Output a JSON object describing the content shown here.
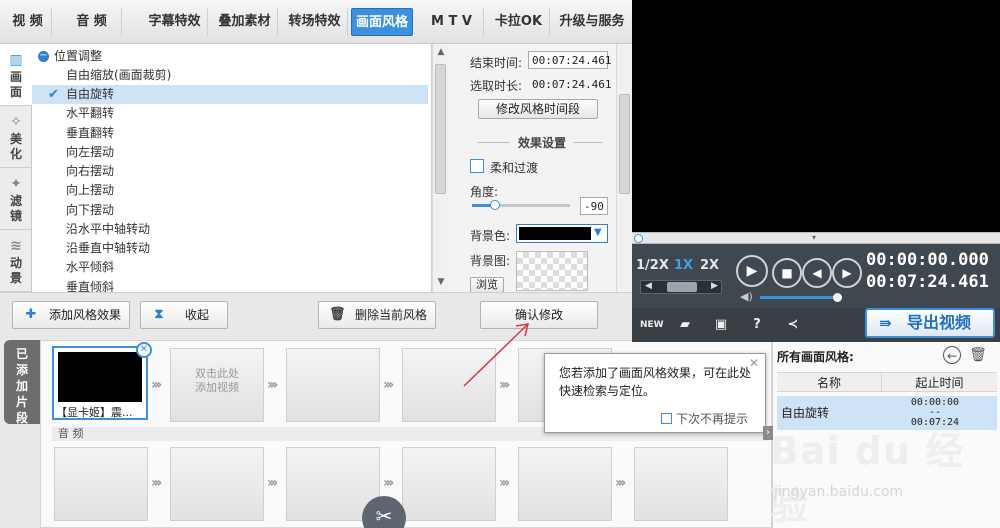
{
  "top_tabs": [
    "视  频",
    "音  频",
    "字幕特效",
    "叠加素材",
    "转场特效",
    "画面风格",
    "M T V",
    "卡拉OK",
    "升级与服务"
  ],
  "top_tabs_active": "画面风格",
  "side_tabs": [
    {
      "label": "画面",
      "icon": "picture-icon",
      "active": true
    },
    {
      "label": "美化",
      "icon": "beautify-wand-icon",
      "active": false
    },
    {
      "label": "滤镜",
      "icon": "filter-wand-icon",
      "active": false
    },
    {
      "label": "动景",
      "icon": "motion-wave-icon",
      "active": false
    }
  ],
  "effect_list": {
    "group": "位置调整",
    "items": [
      "自由缩放(画面裁剪)",
      "自由旋转",
      "水平翻转",
      "垂直翻转",
      "向左摆动",
      "向右摆动",
      "向上摆动",
      "向下摆动",
      "沿水平中轴转动",
      "沿垂直中轴转动",
      "水平倾斜",
      "垂直倾斜"
    ],
    "selected": "自由旋转"
  },
  "settings": {
    "end_time_label": "结束时间:",
    "end_time_value": "00:07:24.461",
    "selected_duration_label": "选取时长:",
    "selected_duration_value": "00:07:24.461",
    "modify_period_button": "修改风格时间段",
    "effect_settings_title": "效果设置",
    "soft_transition_label": "柔和过渡",
    "angle_label": "角度:",
    "angle_value": "-90",
    "bg_color_label": "背景色:",
    "bg_color_hex": "#000000",
    "bg_image_label": "背景图:",
    "browse_button": "浏览"
  },
  "toolbar": {
    "add_style_button": "添加风格效果",
    "collapse_button": "收起",
    "delete_style_button": "删除当前风格",
    "confirm_button": "确认修改"
  },
  "timeline": {
    "added_clips_tab": "已添加片段",
    "clip_name": "【显卡姬】震...",
    "empty_slot_hint_line1": "双击此处",
    "empty_slot_hint_line2": "添加视频",
    "audio_label": "音  频"
  },
  "tooltip": {
    "text": "您若添加了画面风格效果，可在此处快速检索与定位。",
    "dont_show_again": "下次不再提示",
    "close_icon": "close-icon"
  },
  "player": {
    "speed_options": [
      "1/2X",
      "1X",
      "2X"
    ],
    "speed_active": "1X",
    "current_time": "00:00:00.000",
    "total_time": "00:07:24.461",
    "volume": 0.9,
    "seek_progress": 0.0
  },
  "export": {
    "export_button": "导出视频",
    "icons": [
      "new-file-icon",
      "open-folder-icon",
      "save-icon",
      "help-icon",
      "share-icon"
    ]
  },
  "styles_panel": {
    "title": "所有画面风格:",
    "col_name": "名称",
    "col_time": "起止时间",
    "rows": [
      {
        "name": "自由旋转",
        "start": "00:00:00",
        "sep": "--",
        "end": "00:07:24"
      }
    ]
  },
  "watermark": {
    "line1": "Bai du 经验",
    "line2": "jingyan.baidu.com"
  },
  "colors": {
    "accent": "#3d8fe0",
    "selection": "#cfe3f6",
    "player_bg": "#3f474f"
  }
}
